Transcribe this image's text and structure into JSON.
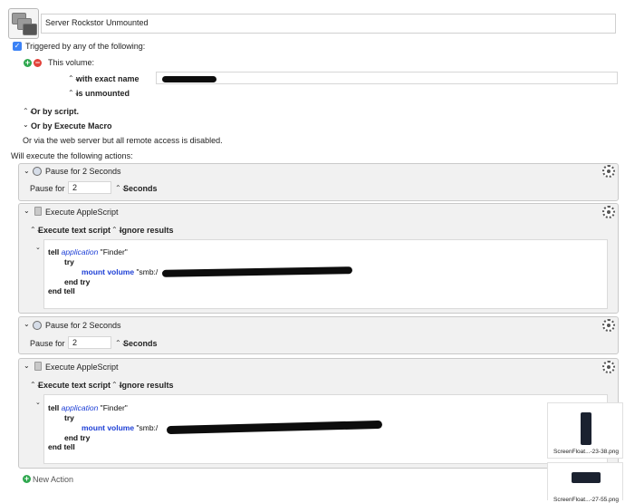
{
  "macro": {
    "name": "Server Rockstor Unmounted"
  },
  "trigger": {
    "checkbox_label": "Triggered by any of the following:",
    "volume_label": "This volume:",
    "exact_name_label": "with exact name",
    "state_label": "is unmounted",
    "or_script": "Or by script.",
    "or_execute": "Or by Execute Macro",
    "web_server": "Or via the web server but all remote access is disabled."
  },
  "actions_header": "Will execute the following actions:",
  "actions": [
    {
      "title": "Pause for 2 Seconds",
      "pause_label": "Pause for",
      "value": "2",
      "unit": "Seconds"
    },
    {
      "title": "Execute AppleScript",
      "mode": "Execute text script",
      "results": "Ignore results",
      "code": {
        "tell": "tell",
        "application": "application",
        "finder": "\"Finder\"",
        "try": "try",
        "mount": "mount volume",
        "smb": "\"smb:/",
        "end_try": "end try",
        "end_tell": "end tell"
      }
    },
    {
      "title": "Pause for 2 Seconds",
      "pause_label": "Pause for",
      "value": "2",
      "unit": "Seconds"
    },
    {
      "title": "Execute AppleScript",
      "mode": "Execute text script",
      "results": "Ignore results",
      "code": {
        "tell": "tell",
        "application": "application",
        "finder": "\"Finder\"",
        "try": "try",
        "mount": "mount volume",
        "smb": "\"smb:/",
        "end_try": "end try",
        "end_tell": "end tell"
      }
    }
  ],
  "new_action": "New Action",
  "desktop": {
    "file1": "ScreenFloat...-23-38.png",
    "file2": "ScreenFloat...-27-55.png"
  }
}
